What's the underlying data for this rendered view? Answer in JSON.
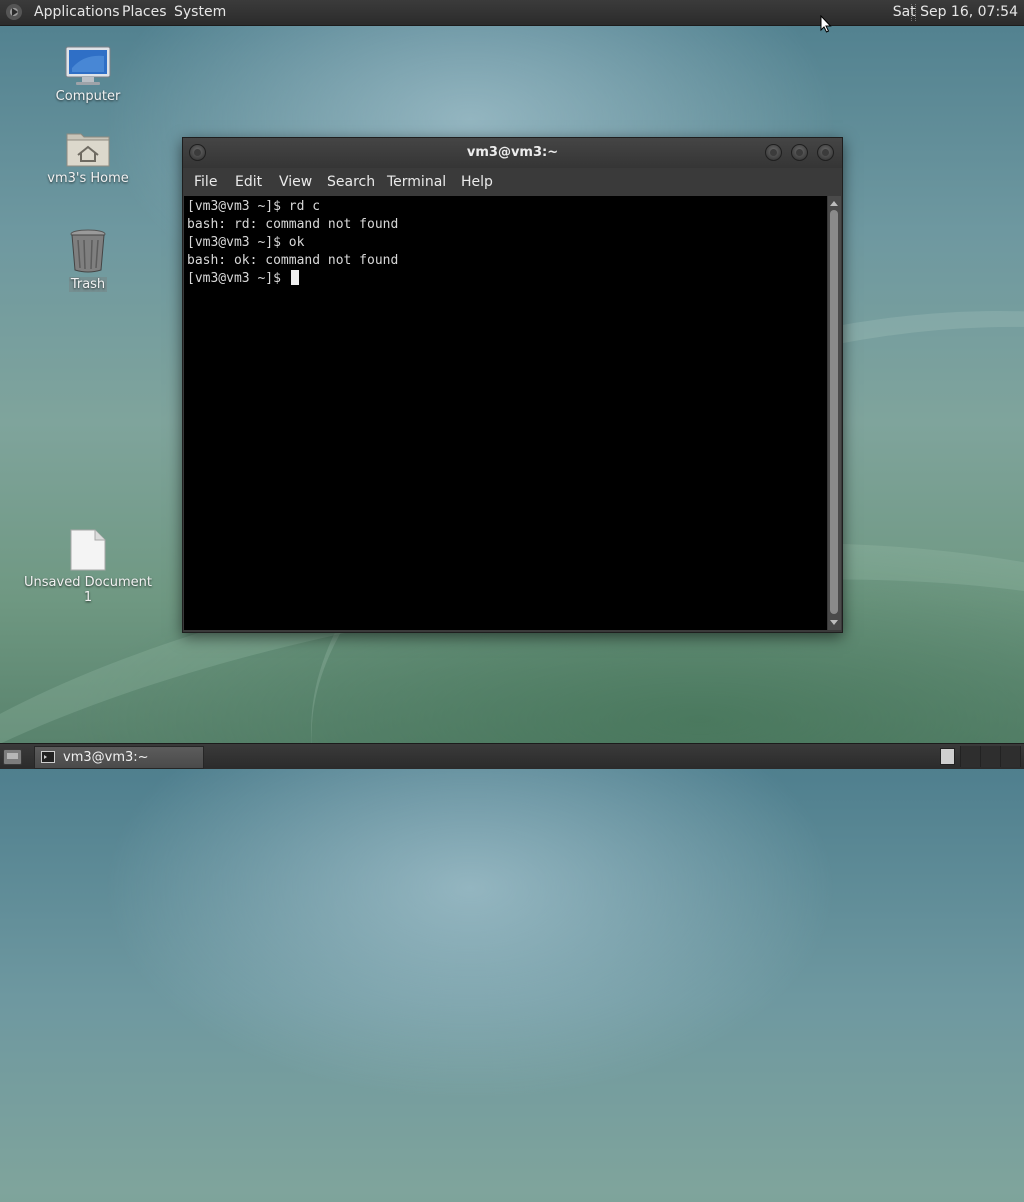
{
  "top_panel": {
    "menus": [
      "Applications",
      "Places",
      "System"
    ],
    "clock": "Sat Sep 16, 07:54"
  },
  "desktop_icons": [
    {
      "label": "Computer"
    },
    {
      "label": "vm3's Home"
    },
    {
      "label": "Trash"
    },
    {
      "label": "Unsaved Document 1"
    }
  ],
  "terminal": {
    "title": "vm3@vm3:~",
    "menus": [
      "File",
      "Edit",
      "View",
      "Search",
      "Terminal",
      "Help"
    ],
    "lines": [
      "[vm3@vm3 ~]$ rd c",
      "bash: rd: command not found",
      "[vm3@vm3 ~]$ ok",
      "bash: ok: command not found",
      "[vm3@vm3 ~]$ "
    ]
  },
  "bottom_panel": {
    "task_label": "vm3@vm3:~"
  },
  "colors": {
    "panel": "#2f2f2f",
    "terminal_bg": "#000000",
    "terminal_fg": "#d8d8d8"
  }
}
